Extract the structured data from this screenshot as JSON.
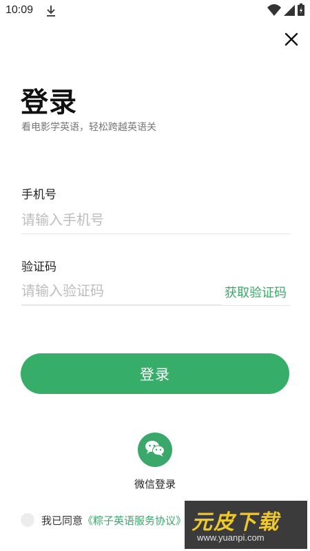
{
  "status_bar": {
    "time": "10:09"
  },
  "header": {
    "title": "登录",
    "subtitle": "看电影学英语，轻松跨越英语关"
  },
  "form": {
    "phone": {
      "label": "手机号",
      "placeholder": "请输入手机号"
    },
    "code": {
      "label": "验证码",
      "placeholder": "请输入验证码",
      "get_code_label": "获取验证码"
    },
    "login_label": "登录"
  },
  "wechat": {
    "label": "微信登录"
  },
  "agreement": {
    "prefix": "我已同意",
    "link": "《粽子英语服务协议》"
  },
  "watermark": {
    "title": "元皮下载",
    "url": "www.yuanpi.com"
  },
  "colors": {
    "accent": "#37ad6a",
    "placeholder": "#bdbdbd",
    "watermark_yellow": "#f0c419"
  },
  "icons": [
    "download-icon",
    "wifi-icon",
    "signal-icon",
    "battery-icon",
    "close-icon",
    "wechat-icon"
  ]
}
